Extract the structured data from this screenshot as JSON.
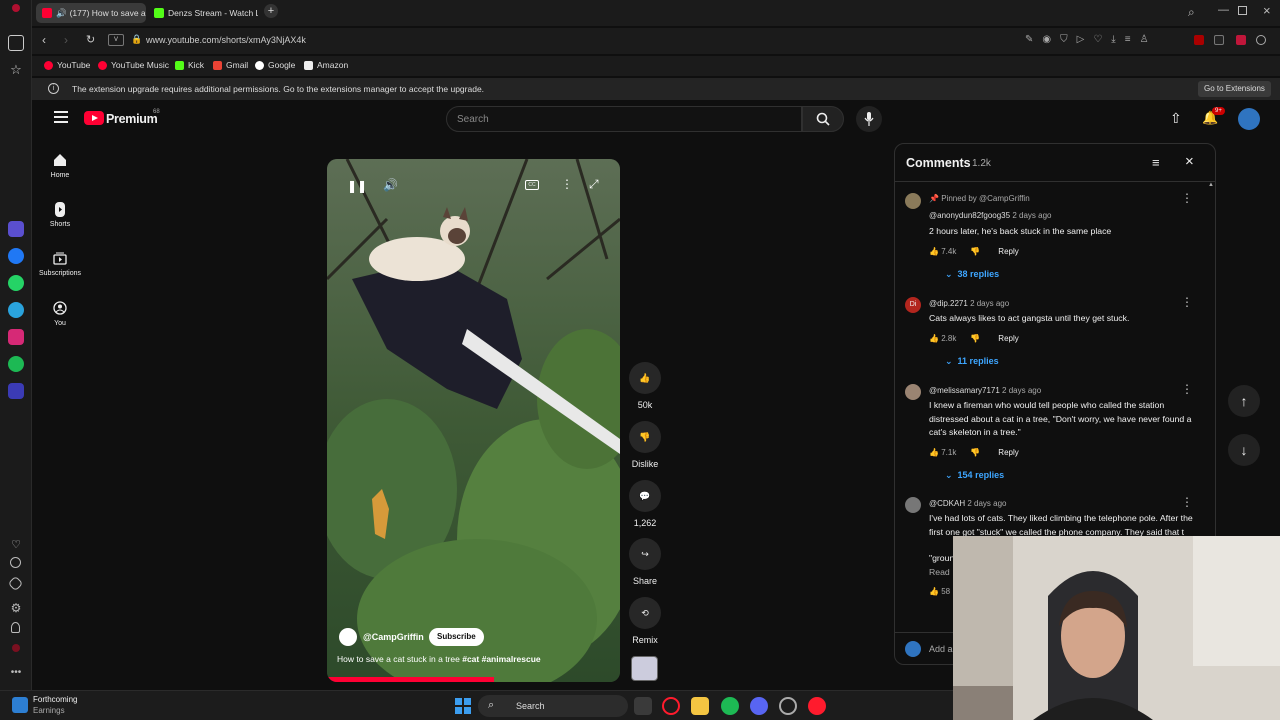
{
  "browser": {
    "tabs": [
      {
        "title": "(177) How to save a c",
        "active": true
      },
      {
        "title": "Denzs Stream - Watch Liv",
        "active": false
      }
    ],
    "new_tab_symbol": "+",
    "address": "www.youtube.com/shorts/xmAy3NjAX4k",
    "bookmarks": [
      "YouTube",
      "YouTube Music",
      "Kick",
      "Gmail",
      "Google",
      "Amazon"
    ],
    "notice": "The extension upgrade requires additional permissions. Go to the extensions manager to accept the upgrade.",
    "notice_button": "Go to Extensions"
  },
  "youtube": {
    "logo": "Premium",
    "logo_sup": "68",
    "search_placeholder": "Search",
    "notification_badge": "9+",
    "nav": [
      "Home",
      "Shorts",
      "Subscriptions",
      "You"
    ]
  },
  "short": {
    "channel": "@CampGriffin",
    "subscribe": "Subscribe",
    "caption": "How to save a cat stuck in a tree",
    "hashtags": "#cat #animalrescue",
    "actions": {
      "likes": "50k",
      "dislike": "Dislike",
      "comments": "1,262",
      "share": "Share",
      "remix": "Remix"
    },
    "progress": 0.57
  },
  "comments": {
    "title": "Comments",
    "count": "1.2k",
    "items": [
      {
        "pinned": "Pinned by @CampGriffin",
        "author": "@anonydun82fgoog35",
        "age": "2 days ago",
        "text": "2 hours later, he's back stuck in the same place",
        "likes": "7.4k",
        "reply": "Reply",
        "replies": "38 replies"
      },
      {
        "pinned": "",
        "author": "@dip.2271",
        "age": "2 days ago",
        "text": "Cats always likes to act gangsta until they get stuck.",
        "likes": "2.8k",
        "reply": "Reply",
        "replies": "11 replies",
        "initials": "Di"
      },
      {
        "pinned": "",
        "author": "@melissamary7171",
        "age": "2 days ago",
        "text": "I knew a fireman who would tell people who called the station distressed about a cat in a tree, \"Don't worry, we have never found a cat's skeleton in a tree.\"",
        "likes": "7.1k",
        "reply": "Reply",
        "replies": "154 replies"
      },
      {
        "pinned": "",
        "author": "@CDKAH",
        "age": "2 days ago",
        "text": "I've had lots of cats.  They liked climbing the telephone pole.  After the first one got \"stuck\" we called the phone company.  They said that t",
        "text_more": "\"groun",
        "read_more": "Read",
        "likes": "58"
      }
    ],
    "add_placeholder": "Add a"
  },
  "taskbar": {
    "weather_title": "Forthcoming",
    "weather_sub": "Earnings",
    "search": "Search"
  },
  "colors": {
    "accent_red": "#ff0033",
    "link_blue": "#3ea6ff"
  }
}
